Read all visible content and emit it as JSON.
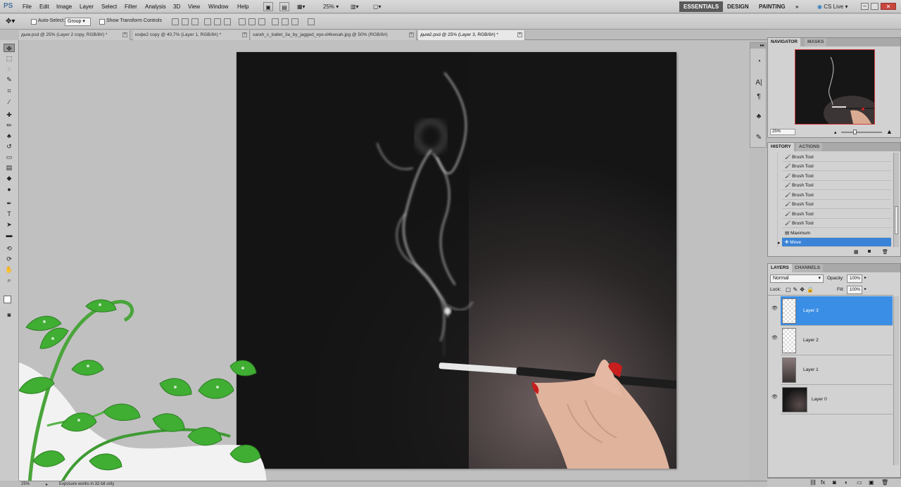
{
  "app": {
    "logo": "PS"
  },
  "menu": [
    "File",
    "Edit",
    "Image",
    "Layer",
    "Select",
    "Filter",
    "Analysis",
    "3D",
    "View",
    "Window",
    "Help"
  ],
  "menubar_controls": {
    "zoom": "25%"
  },
  "workspaces": {
    "essentials": "ESSENTIALS",
    "design": "DESIGN",
    "painting": "PAINTING",
    "more": "»",
    "cs_live": "CS Live"
  },
  "options": {
    "auto_select_label": "Auto-Select:",
    "auto_select_value": "Group",
    "show_transform_label": "Show Transform Controls"
  },
  "tabs": [
    {
      "label": "дым.psd @ 25% (Layer 2 copy, RGB/8#) *",
      "active": false
    },
    {
      "label": "кофе2 copy @ 40,7% (Layer 1, RGB/8#) *",
      "active": false
    },
    {
      "label": "sarah_c_ballet_3a_by_jagged_eye-d4kwsah.jpg @ 50% (RGB/8#)",
      "active": false
    },
    {
      "label": "дым2.psd @ 25% (Layer 3, RGB/8#) *",
      "active": true
    }
  ],
  "navigator": {
    "tabs": [
      "NAVIGATOR",
      "MASKS"
    ],
    "zoom": "25%"
  },
  "history": {
    "tabs": [
      "HISTORY",
      "ACTIONS"
    ],
    "items": [
      "Brush Tool",
      "Brush Tool",
      "Brush Tool",
      "Brush Tool",
      "Brush Tool",
      "Brush Tool",
      "Brush Tool",
      "Brush Tool",
      "Maximum",
      "Move"
    ],
    "selected_index": 9
  },
  "layers": {
    "tabs": [
      "LAYERS",
      "CHANNELS"
    ],
    "blend_mode": "Normal",
    "opacity_label": "Opacity:",
    "opacity": "100%",
    "lock_label": "Lock:",
    "fill_label": "Fill:",
    "fill": "100%",
    "items": [
      {
        "name": "Layer 3",
        "selected": true,
        "visible": true
      },
      {
        "name": "Layer 2",
        "selected": false,
        "visible": true
      },
      {
        "name": "Layer 1",
        "selected": false,
        "visible": false
      },
      {
        "name": "Layer 0",
        "selected": false,
        "visible": true
      }
    ]
  },
  "status": {
    "zoom": "25%",
    "message": "Exposure works in 32-bit only"
  },
  "colors": {
    "accent": "#3a8ee6",
    "selection": "#3a83d6"
  }
}
